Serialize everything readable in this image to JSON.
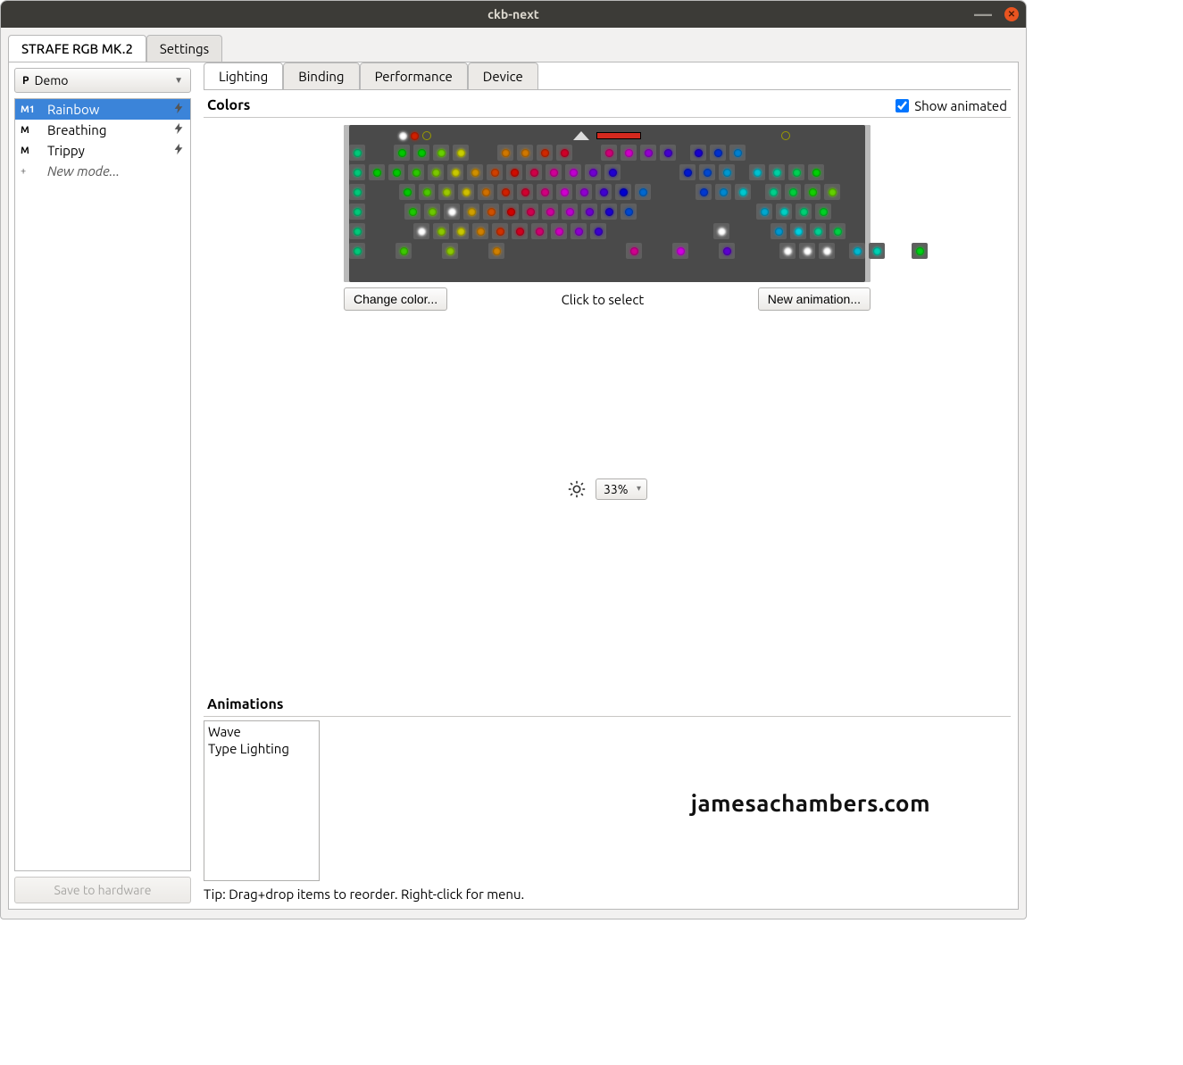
{
  "window": {
    "title": "ckb-next"
  },
  "outer_tabs": [
    {
      "label": "STRAFE RGB MK.2",
      "active": true
    },
    {
      "label": "Settings",
      "active": false
    }
  ],
  "profile": {
    "badge": "P",
    "name": "Demo"
  },
  "modes": [
    {
      "badge": "M1",
      "name": "Rainbow",
      "selected": true,
      "hasBolt": true
    },
    {
      "badge": "M",
      "name": "Breathing",
      "selected": false,
      "hasBolt": true
    },
    {
      "badge": "M",
      "name": "Trippy",
      "selected": false,
      "hasBolt": true
    },
    {
      "badge": "+",
      "name": "New mode...",
      "selected": false,
      "hasBolt": false,
      "isNew": true
    }
  ],
  "save_button": "Save to hardware",
  "inner_tabs": [
    {
      "label": "Lighting",
      "active": true
    },
    {
      "label": "Binding",
      "active": false
    },
    {
      "label": "Performance",
      "active": false
    },
    {
      "label": "Device",
      "active": false
    }
  ],
  "colors": {
    "heading": "Colors",
    "show_animated_label": "Show animated",
    "show_animated_checked": true,
    "change_color_btn": "Change color...",
    "click_to_select": "Click to select",
    "new_animation_btn": "New animation..."
  },
  "brightness": {
    "value": "33%"
  },
  "animations": {
    "heading": "Animations",
    "items": [
      "Wave",
      "Type Lighting"
    ],
    "tip": "Tip: Drag+drop items to reorder. Right-click for menu."
  },
  "watermark": "jamesachambers.com",
  "kbd_rows": [
    [
      "#00c97a",
      24,
      "#00c900",
      "#00c900",
      "#68d000",
      "#c9d000",
      24,
      "#d07800",
      "#d07800",
      "#d02800",
      "#d00028",
      24,
      "#d00078",
      "#d000c8",
      "#9400d0",
      "#4400d0",
      8,
      "#1800d0",
      "#0030d0",
      "#0080d0"
    ],
    [
      "#00c97a",
      "#00c900",
      "#00c900",
      "#2cc900",
      "#7cc900",
      "#c9c900",
      "#d09000",
      "#d04000",
      "#d00c00",
      "#d00048",
      "#d00098",
      "#c000d0",
      "#7000d0",
      "#2000d0",
      46,
      8,
      "#0018d0",
      "#0048d0",
      "#0098d0",
      8,
      "#00c1d0",
      "#00d0a4",
      "#00d054",
      "#00d004"
    ],
    [
      "#00c97a",
      30,
      "#00c900",
      "#4cc900",
      "#9cc900",
      "#d0c000",
      "#d07000",
      "#d02000",
      "#d00030",
      "#d00080",
      "#d000d0",
      "#9000d0",
      "#4000d0",
      "#0000d0",
      "#0068d0",
      30,
      8,
      "#0038d0",
      "#0088d0",
      "#00c8d0",
      8,
      "#00d08c",
      "#00d03c",
      "#14d000",
      "#64d000"
    ],
    [
      "#00c97a",
      36,
      "#1cc900",
      "#6cc900",
      "#fff",
      "#d0a000",
      "#d05000",
      "#d00000",
      "#d00050",
      "#d000a0",
      "#bc00d0",
      "#6c00d0",
      "#1c00d0",
      "#0048d0",
      52,
      70,
      "#00a8d0",
      "#00d0c4",
      "#00d074",
      "#00d024"
    ],
    [
      "#00c97a",
      46,
      "#fff",
      "#8cc900",
      "#c9c800",
      "#d08000",
      "#d03000",
      "#d00020",
      "#d00070",
      "#d000c0",
      "#8c00d0",
      "#3c00d0",
      80,
      28,
      "#fff",
      26,
      8,
      "#0098d0",
      "#00d0e0",
      "#00d094",
      "#00d044"
    ],
    [
      "#00c97a",
      26,
      "#3cc900",
      26,
      "#8cc900",
      26,
      "#d08000",
      128,
      "#d00090",
      26,
      "#d000e0",
      26,
      "#5c00d0",
      26,
      12,
      "#fff",
      "#fff",
      "#fff",
      8,
      "#00b8d0",
      "#00d0b4",
      22,
      "#00d014"
    ]
  ]
}
